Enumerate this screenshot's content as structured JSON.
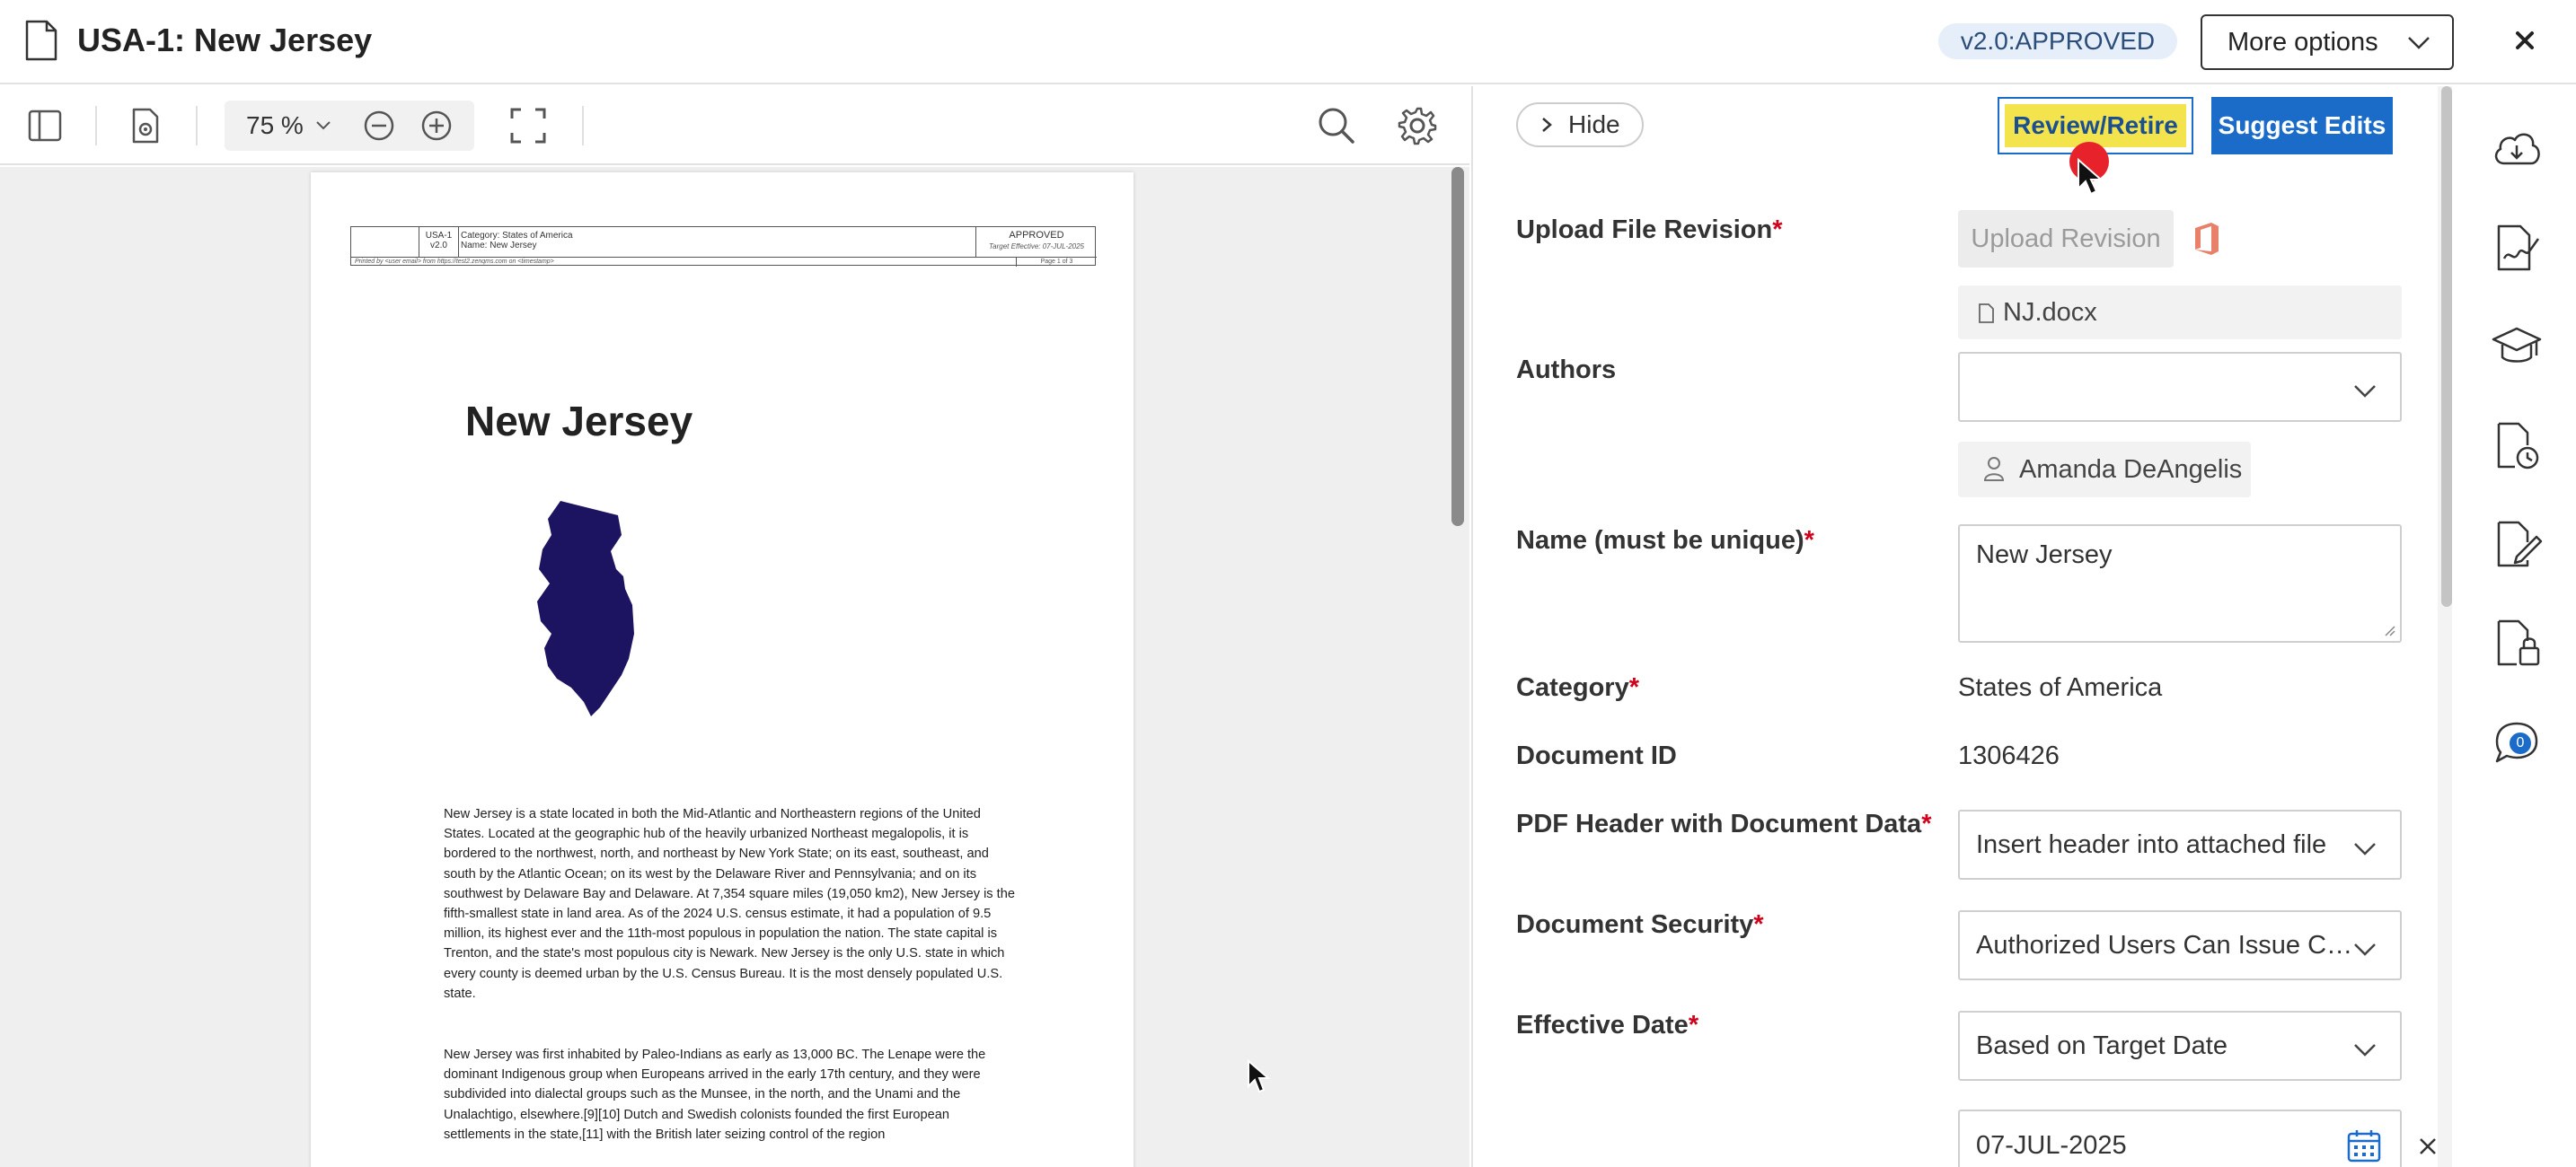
{
  "window": {
    "title": "USA-1: New Jersey",
    "status": "v2.0:APPROVED",
    "more_options_label": "More options"
  },
  "viewer": {
    "zoom_value": "75 %",
    "page": {
      "header": {
        "doc_number": "USA-1",
        "version": "v2.0",
        "category_line": "Category: States of America",
        "name_line": "Name: New Jersey",
        "status": "APPROVED",
        "status_sub": "Target Effective: 07-JUL-2025",
        "printed_by": "Printed by <user email> from https://test2.zenqms.com on <timestamp>",
        "page_of": "Page 1 of 3"
      },
      "title": "New Jersey",
      "paragraph_1": "New Jersey is a state located in both the Mid-Atlantic and Northeastern regions of the United States. Located at the geographic hub of the heavily urbanized Northeast megalopolis, it is bordered to the northwest, north, and northeast by New York State; on its east, southeast, and south by the Atlantic Ocean; on its west by the Delaware River and Pennsylvania; and on its southwest by Delaware Bay and Delaware. At 7,354 square miles (19,050 km2), New Jersey is the fifth-smallest state in land area. As of the 2024 U.S. census estimate, it had a population of 9.5 million, its highest ever and the 11th-most populous in population the nation. The state capital is Trenton, and the state's most populous city is Newark. New Jersey is the only U.S. state in which every county is deemed urban by the U.S. Census Bureau. It is the most densely populated U.S. state.",
      "paragraph_2": "New Jersey was first inhabited by Paleo-Indians as early as 13,000 BC. The Lenape were the dominant Indigenous group when Europeans arrived in the early 17th century, and they were subdivided into dialectal groups such as the Munsee, in the north, and the Unami and the Unalachtigo, elsewhere.[9][10] Dutch and Swedish colonists founded the first European settlements in the state,[11] with the British later seizing control of the region"
    }
  },
  "panel": {
    "hide_label": "Hide",
    "review_label": "Review/Retire",
    "suggest_label": "Suggest Edits",
    "fields": {
      "upload": {
        "label": "Upload File Revision",
        "required_mark": "*",
        "button": "Upload Revision",
        "file_name": "NJ.docx"
      },
      "authors": {
        "label": "Authors",
        "selected": "",
        "author_name": "Amanda DeAngelis"
      },
      "name": {
        "label": "Name (must be unique)",
        "required_mark": "*",
        "value": "New Jersey"
      },
      "category": {
        "label": "Category",
        "required_mark": "*",
        "value": "States of America"
      },
      "document_id": {
        "label": "Document ID",
        "value": "1306426"
      },
      "pdf_header": {
        "label": "PDF Header with Document Data",
        "required_mark": "*",
        "value": "Insert header into attached file"
      },
      "security": {
        "label": "Document Security",
        "required_mark": "*",
        "value": "Authorized Users Can Issue Co..."
      },
      "effective_date": {
        "label": "Effective Date",
        "required_mark": "*",
        "value": "Based on Target Date",
        "date": "07-JUL-2025"
      }
    }
  },
  "rail": {
    "comments_count": "0",
    "icons": [
      "cloud-download-icon",
      "signature-icon",
      "training-cap-icon",
      "history-icon",
      "edit-doc-icon",
      "lock-doc-icon",
      "comment-icon"
    ]
  },
  "colors": {
    "accent": "#1b6bc9",
    "highlight": "#f3e44d",
    "required": "#d0021b",
    "status_pill_bg": "#e6eef9",
    "map_fill": "#1c1361"
  }
}
